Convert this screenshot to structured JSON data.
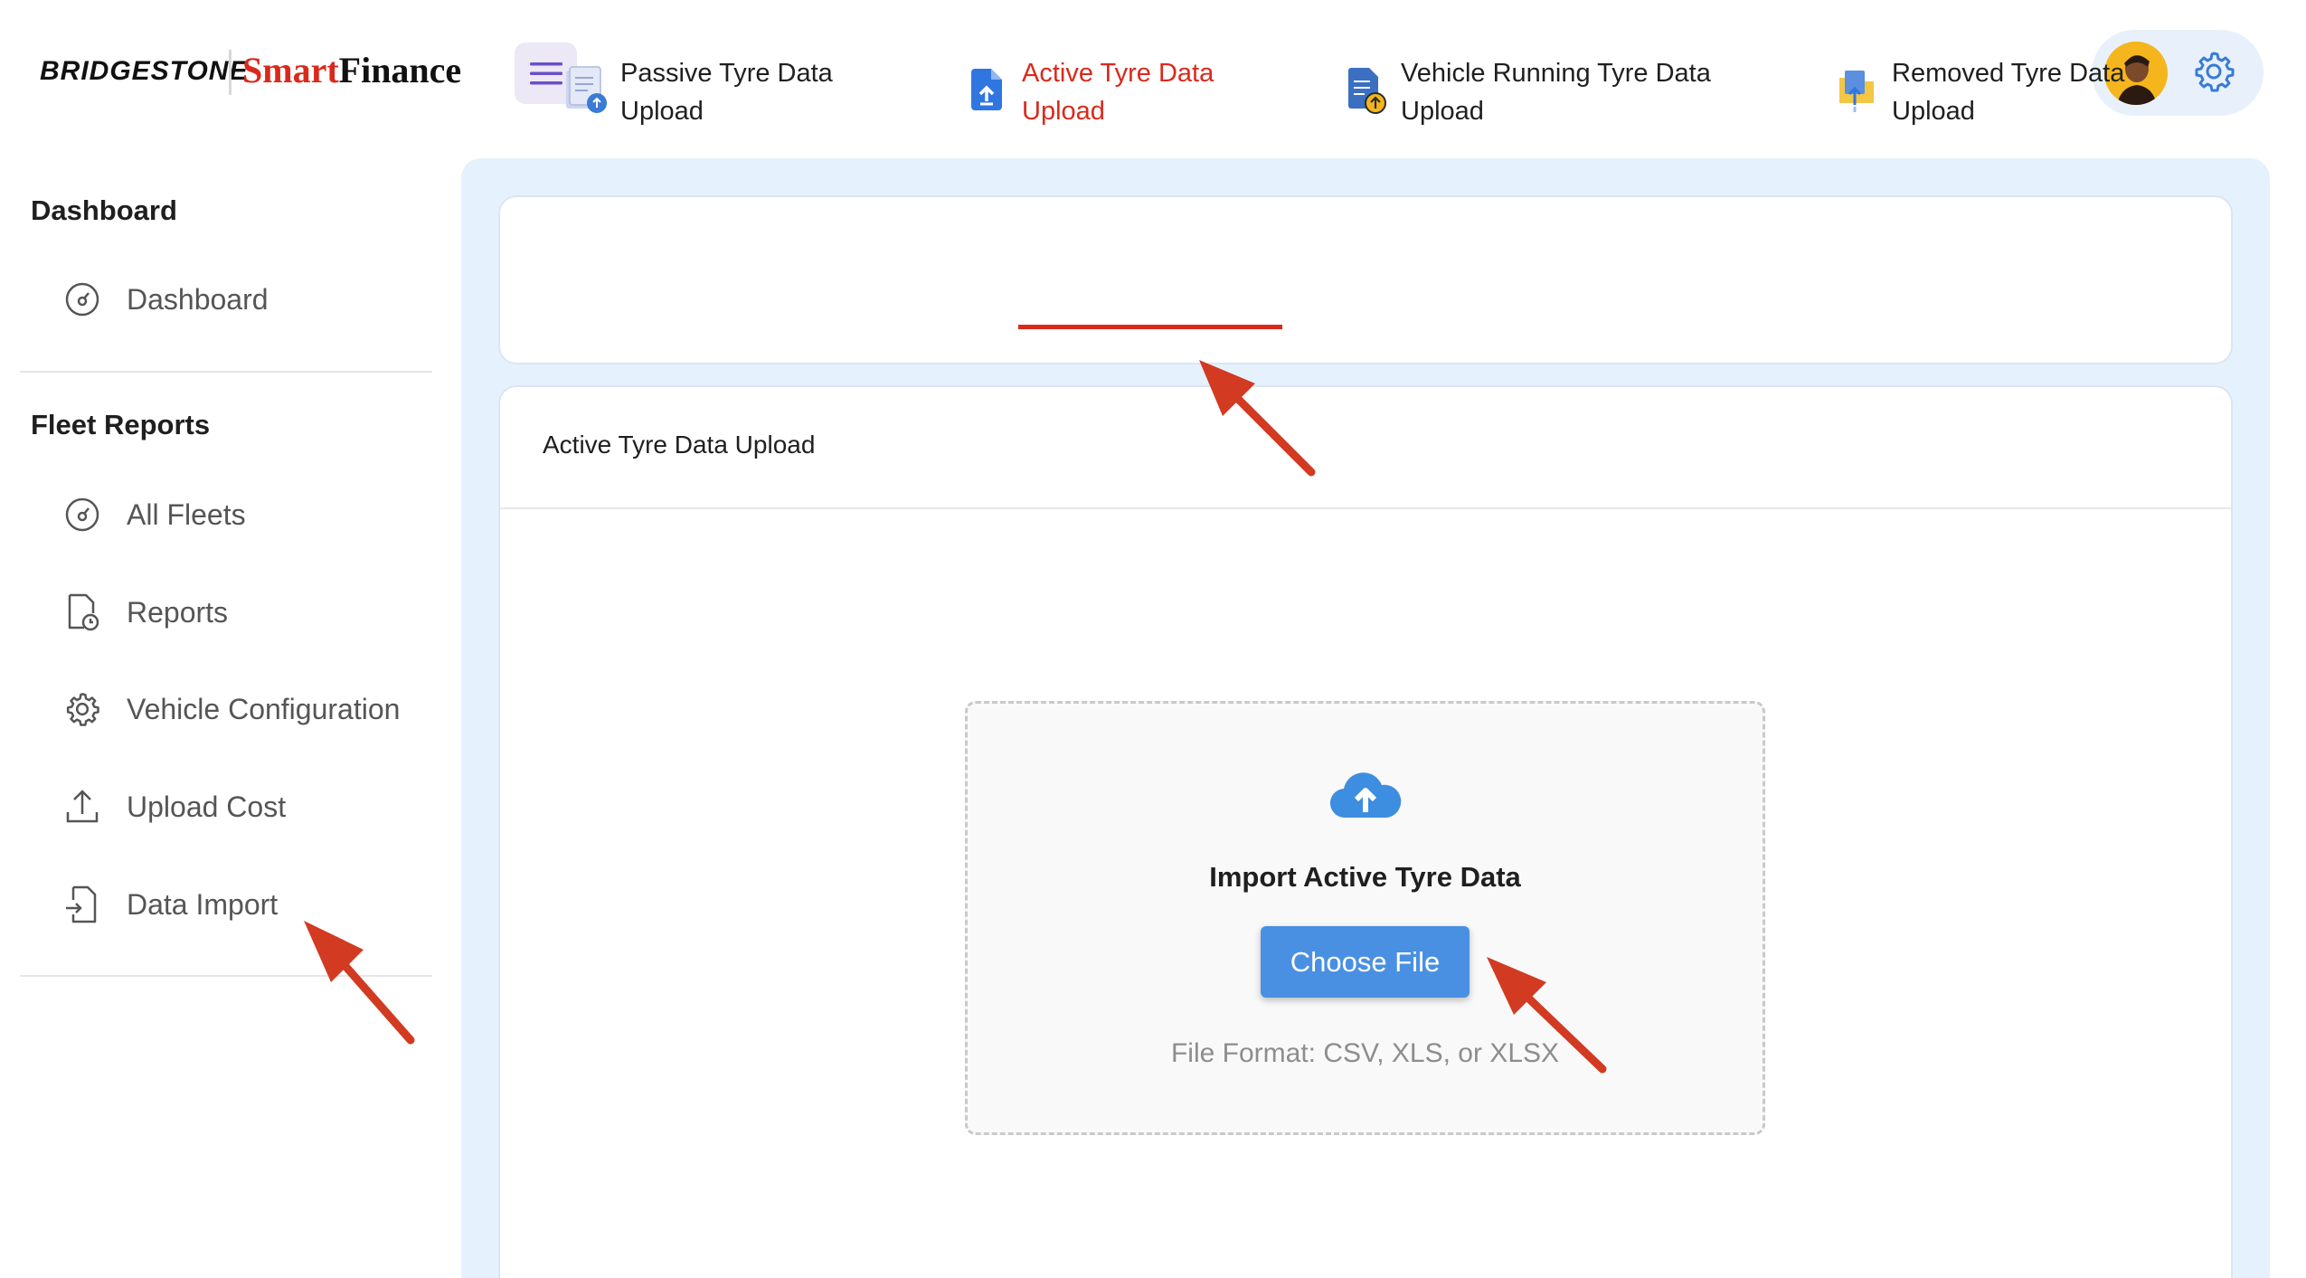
{
  "header": {
    "brand": "BRIDGESTONE",
    "product_prefix": "Smart",
    "product_suffix": "Finance",
    "menu_icon": "hamburger-menu-icon",
    "settings_icon": "gear-icon",
    "avatar_icon": "user-avatar"
  },
  "sidebar": {
    "sections": [
      {
        "title": "Dashboard",
        "items": [
          {
            "label": "Dashboard",
            "icon": "gauge-icon"
          }
        ]
      },
      {
        "title": "Fleet Reports",
        "items": [
          {
            "label": "All Fleets",
            "icon": "gauge-icon"
          },
          {
            "label": "Reports",
            "icon": "report-clock-icon"
          },
          {
            "label": "Vehicle Configuration",
            "icon": "gear-icon"
          },
          {
            "label": "Upload Cost",
            "icon": "upload-icon"
          },
          {
            "label": "Data Import",
            "icon": "file-import-icon"
          }
        ]
      }
    ]
  },
  "tabs": [
    {
      "line1": "Passive Tyre Data",
      "line2": "Upload",
      "icon": "passive-document-icon",
      "active": false
    },
    {
      "line1": "Active Tyre Data",
      "line2": "Upload",
      "icon": "active-upload-document-icon",
      "active": true
    },
    {
      "line1": "Vehicle Running Tyre Data",
      "line2": "Upload",
      "icon": "vehicle-running-document-icon",
      "active": false
    },
    {
      "line1": "Removed Tyre Data",
      "line2": "Upload",
      "icon": "removed-folder-icon",
      "active": false
    }
  ],
  "upload": {
    "card_title": "Active Tyre Data Upload",
    "import_title": "Import Active Tyre Data",
    "button_label": "Choose File",
    "format_note": "File Format: CSV, XLS, or XLSX",
    "icon": "cloud-upload-icon"
  },
  "colors": {
    "accent_red": "#d9291c",
    "button_blue": "#4a90e2",
    "content_bg": "#e5f1fc"
  }
}
